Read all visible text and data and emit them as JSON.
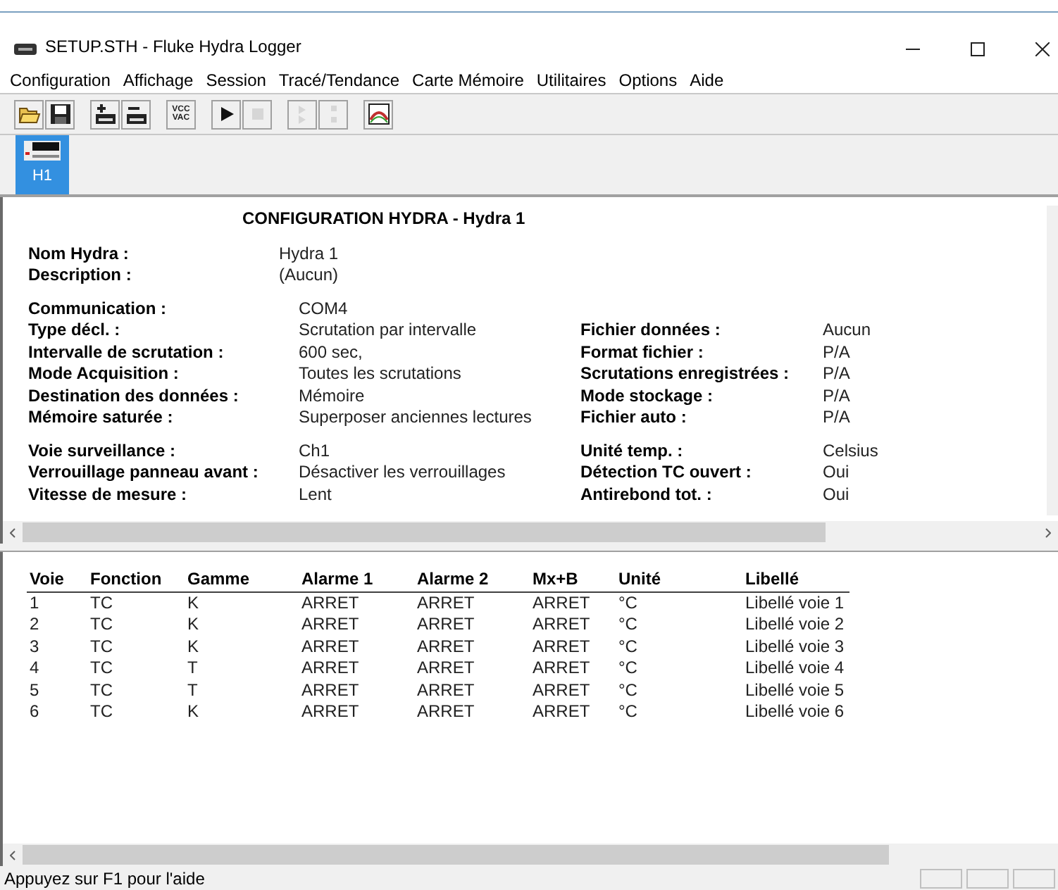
{
  "window": {
    "title": "SETUP.STH - Fluke Hydra Logger"
  },
  "menu": [
    "Configuration",
    "Affichage",
    "Session",
    "Tracé/Tendance",
    "Carte Mémoire",
    "Utilitaires",
    "Options",
    "Aide"
  ],
  "toolbar": [
    {
      "kind": "open",
      "disabled": false
    },
    {
      "kind": "save",
      "disabled": false
    },
    {
      "kind": "sep"
    },
    {
      "kind": "add",
      "disabled": false
    },
    {
      "kind": "remove",
      "disabled": false
    },
    {
      "kind": "sep"
    },
    {
      "kind": "text",
      "label": "VCC VAC",
      "disabled": false
    },
    {
      "kind": "sep"
    },
    {
      "kind": "play",
      "disabled": false
    },
    {
      "kind": "stop",
      "disabled": true
    },
    {
      "kind": "sep"
    },
    {
      "kind": "step",
      "disabled": true
    },
    {
      "kind": "pause",
      "disabled": true
    },
    {
      "kind": "sep"
    },
    {
      "kind": "chart",
      "disabled": false
    }
  ],
  "tabs": [
    {
      "label": "H1",
      "selected": true
    }
  ],
  "config": {
    "heading": "CONFIGURATION HYDRA - Hydra 1",
    "sections": [
      {
        "kind": "narrow",
        "rows": [
          {
            "label": "Nom Hydra :",
            "value": "Hydra 1"
          },
          {
            "label": "Description :",
            "value": "(Aucun)"
          }
        ]
      },
      {
        "kind": "wide",
        "rows": [
          {
            "label": "Communication :",
            "value": "COM4"
          },
          {
            "label": "Type décl. :",
            "value": "Scrutation par intervalle",
            "right": {
              "label": "Fichier données :",
              "value": "Aucun"
            }
          },
          {
            "label": "Intervalle de scrutation :",
            "value": "600 sec,",
            "right": {
              "label": "Format fichier :",
              "value": "P/A"
            }
          },
          {
            "label": "Mode Acquisition :",
            "value": "Toutes les scrutations",
            "right": {
              "label": "Scrutations enregistrées :",
              "value": "P/A"
            }
          },
          {
            "label": "Destination des données :",
            "value": "Mémoire",
            "right": {
              "label": "Mode stockage :",
              "value": "P/A"
            }
          },
          {
            "label": "Mémoire saturée :",
            "value": "Superposer anciennes lectures",
            "right": {
              "label": "Fichier auto :",
              "value": "P/A"
            }
          }
        ]
      },
      {
        "kind": "wide",
        "rows": [
          {
            "label": "Voie surveillance :",
            "value": "Ch1",
            "right": {
              "label": "Unité temp. :",
              "value": "Celsius"
            }
          },
          {
            "label": "Verrouillage panneau avant :",
            "value": "Désactiver les verrouillages",
            "right": {
              "label": "Détection TC ouvert :",
              "value": "Oui"
            }
          },
          {
            "label": "Vitesse de mesure :",
            "value": "Lent",
            "right": {
              "label": "Antirebond tot. :",
              "value": "Oui"
            }
          }
        ]
      }
    ]
  },
  "table": {
    "columns": [
      "Voie",
      "Fonction",
      "Gamme",
      "Alarme 1",
      "Alarme 2",
      "Mx+B",
      "Unité",
      "Libellé"
    ],
    "rows": [
      [
        "1",
        "TC",
        "K",
        "ARRET",
        "ARRET",
        "ARRET",
        "°C",
        "Libellé voie 1"
      ],
      [
        "2",
        "TC",
        "K",
        "ARRET",
        "ARRET",
        "ARRET",
        "°C",
        "Libellé voie 2"
      ],
      [
        "3",
        "TC",
        "K",
        "ARRET",
        "ARRET",
        "ARRET",
        "°C",
        "Libellé voie 3"
      ],
      [
        "4",
        "TC",
        "T",
        "ARRET",
        "ARRET",
        "ARRET",
        "°C",
        "Libellé voie 4"
      ],
      [
        "5",
        "TC",
        "T",
        "ARRET",
        "ARRET",
        "ARRET",
        "°C",
        "Libellé voie 5"
      ],
      [
        "6",
        "TC",
        "K",
        "ARRET",
        "ARRET",
        "ARRET",
        "°C",
        "Libellé voie 6"
      ]
    ]
  },
  "status_bar": {
    "text": "Appuyez sur F1 pour l'aide"
  }
}
